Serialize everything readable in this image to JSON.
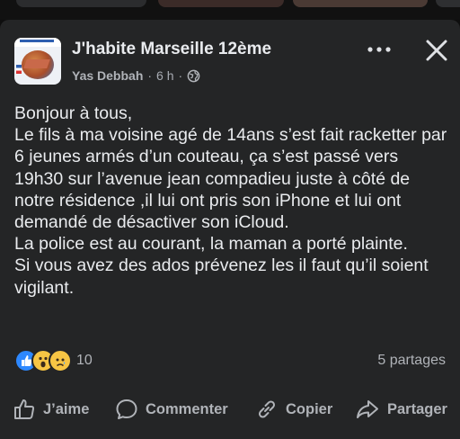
{
  "post": {
    "group_name": "J'habite Marseille 12ème",
    "author": "Yas Debbah",
    "time": "6 h",
    "separator": "·",
    "paragraphs": [
      "Bonjour à tous,",
      "Le fils à ma voisine agé de 14ans s’est fait racketter par 6 jeunes armés d’un couteau, ça s’est passé vers 19h30 sur l’avenue jean compadieu juste à côté de notre résidence ,il lui ont pris son iPhone et lui ont demandé de désactiver son iCloud.",
      "La police est au courant, la maman a porté plainte.",
      "Si vous avez des ados prévenez les il faut qu’il soient vigilant."
    ]
  },
  "reactions": {
    "icons": [
      "like-reaction",
      "wow-reaction",
      "sad-reaction"
    ],
    "count": "10",
    "shares": "5 partages"
  },
  "actions": {
    "like": "J’aime",
    "comment": "Commenter",
    "copy": "Copier",
    "share": "Partager"
  },
  "icons": {
    "more": "more-dots-icon",
    "close": "close-icon",
    "audience": "globe-icon"
  },
  "colors": {
    "card_bg": "#242526",
    "text": "#e4e6eb",
    "secondary": "#b0b3b8",
    "like_blue": "#2d88ff"
  }
}
